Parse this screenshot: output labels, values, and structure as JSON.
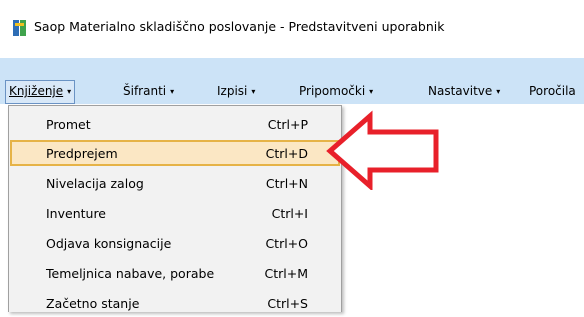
{
  "window": {
    "title": "Saop  Materialno skladiščno poslovanje - Predstavitveni uporabnik",
    "icon": "saop-app-icon"
  },
  "menubar": {
    "items": [
      {
        "label": "Knjiženje",
        "caret": "▾"
      },
      {
        "label": "Šifranti",
        "caret": "▾"
      },
      {
        "label": "Izpisi",
        "caret": "▾"
      },
      {
        "label": "Pripomočki",
        "caret": "▾"
      },
      {
        "label": "Nastavitve",
        "caret": "▾"
      },
      {
        "label": "Poročila"
      }
    ]
  },
  "dropdown": {
    "items": [
      {
        "label": "Promet",
        "shortcut": "Ctrl+P"
      },
      {
        "label": "Predprejem",
        "shortcut": "Ctrl+D",
        "selected": true
      },
      {
        "label": "Nivelacija zalog",
        "shortcut": "Ctrl+N"
      },
      {
        "label": "Inventure",
        "shortcut": "Ctrl+I"
      },
      {
        "label": "Odjava konsignacije",
        "shortcut": "Ctrl+O"
      },
      {
        "label": "Temeljnica nabave, porabe",
        "shortcut": "Ctrl+M"
      },
      {
        "label": "Začetno stanje",
        "shortcut": "Ctrl+S"
      }
    ]
  },
  "annotation": {
    "icon": "red-arrow-left-icon",
    "color": "#e8202a"
  },
  "colors": {
    "menubar": "#cce3f7",
    "selected_bg": "#fbe7c4",
    "selected_border": "#e6b347"
  }
}
